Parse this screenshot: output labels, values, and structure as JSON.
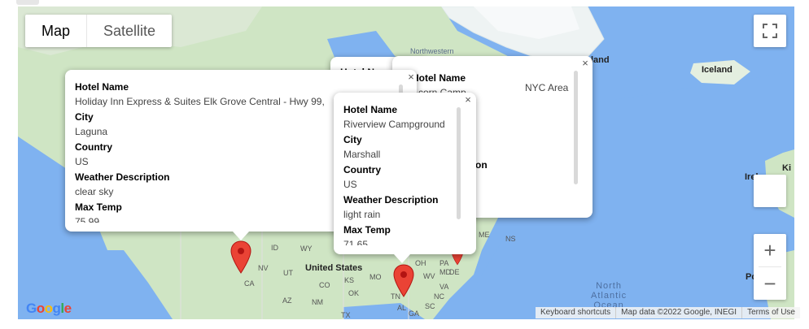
{
  "map_type": {
    "map_label": "Map",
    "satellite_label": "Satellite",
    "selected": "Map"
  },
  "map_labels": {
    "iceland": "Iceland",
    "greenland": "land",
    "united_states": "United States",
    "north_atlantic": "North\nAtlantic\nOcean",
    "northwestern": "Northwestern",
    "ireland": "Irel",
    "ki": "Ki",
    "po": "Po",
    "nyc": "NYC Area",
    "states": [
      "ID",
      "WY",
      "NV",
      "UT",
      "CO",
      "CA",
      "AZ",
      "NM",
      "OK",
      "TX",
      "MO",
      "KS",
      "WV",
      "VA",
      "PA",
      "MD",
      "DE",
      "NC",
      "SC",
      "AL",
      "GA",
      "TN",
      "OH",
      "NS",
      "ME"
    ]
  },
  "info_windows": [
    {
      "hotel_name_label": "Hotel Name",
      "hotel_name": "Holiday Inn Express & Suites Elk Grove Central - Hwy 99,",
      "city_label": "City",
      "city": "Laguna",
      "country_label": "Country",
      "country": "US",
      "weather_label": "Weather Description",
      "weather": "clear sky",
      "max_temp_label": "Max Temp",
      "max_temp": "75.99"
    },
    {
      "hotel_name_label": "Hotel Name",
      "hotel_name": "Riverview Campground",
      "city_label": "City",
      "city": "Marshall",
      "country_label": "Country",
      "country": "US",
      "weather_label": "Weather Description",
      "weather": "light rain",
      "max_temp_label": "Max Temp",
      "max_temp": "71.65"
    },
    {
      "hotel_name_label": "Hotel Name",
      "hotel_name": "Acorn Camp",
      "weather_label": "iption"
    },
    {
      "hotel_name_label": "Hotel N"
    }
  ],
  "close_glyph": "×",
  "zoom": {
    "in": "+",
    "out": "−"
  },
  "attribution": {
    "shortcuts": "Keyboard shortcuts",
    "data": "Map data ©2022 Google, INEGI",
    "terms": "Terms of Use"
  },
  "logo": "Google",
  "colors": {
    "water": "#7fb2f0",
    "land": "#cfe5c4",
    "marker": "#ea4335"
  }
}
